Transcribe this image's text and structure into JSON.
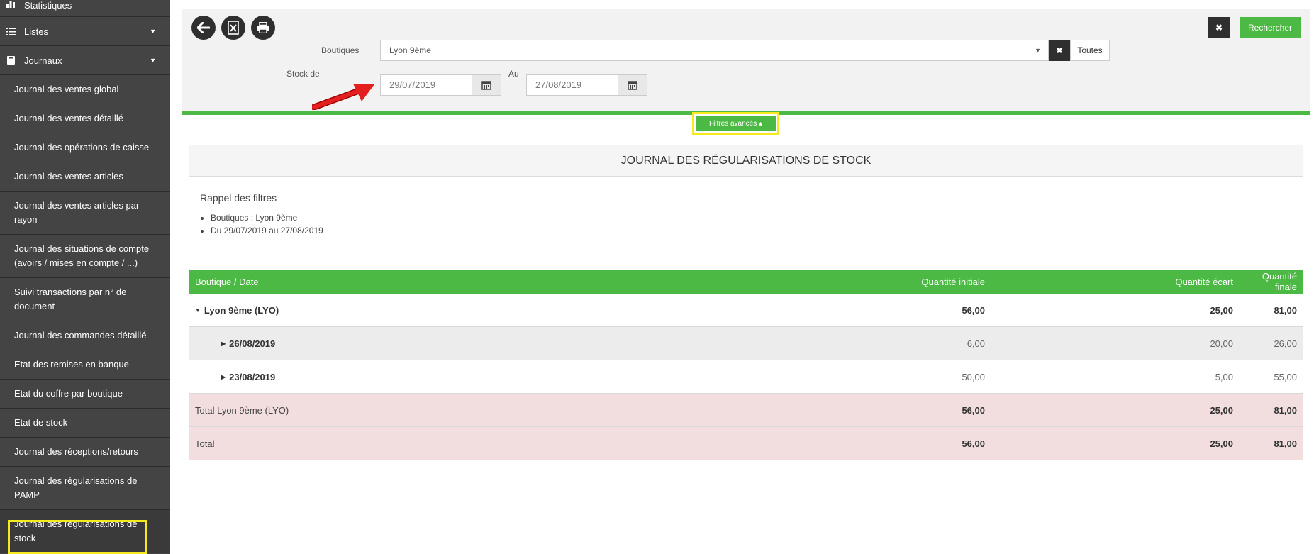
{
  "sidebar": {
    "top_items": [
      {
        "label": "Statistiques",
        "icon": "bar-chart-icon"
      },
      {
        "label": "Listes",
        "icon": "list-icon"
      },
      {
        "label": "Journaux",
        "icon": "book-icon"
      }
    ],
    "items": [
      "Journal des ventes global",
      "Journal des ventes détaillé",
      "Journal des opérations de caisse",
      "Journal des ventes articles",
      "Journal des ventes articles par rayon",
      "Journal des situations de compte (avoirs / mises en compte / ...)",
      "Suivi transactions par n° de document",
      "Journal des commandes détaillé",
      "Etat des remises en banque",
      "Etat du coffre par boutique",
      "Etat de stock",
      "Journal des réceptions/retours",
      "Journal des régularisations de PAMP",
      "Journal des régularisations de stock"
    ]
  },
  "filters": {
    "boutiques_label": "Boutiques",
    "boutiques_value": "Lyon 9ème",
    "toutes_label": "Toutes",
    "stock_label": "Stock de",
    "date_from": "29/07/2019",
    "au_label": "Au",
    "date_to": "27/08/2019",
    "search_label": "Rechercher",
    "advanced_label": "Filtres avancés ▴"
  },
  "report": {
    "title": "JOURNAL DES RÉGULARISATIONS DE STOCK",
    "recap_title": "Rappel des filtres",
    "recap_items": [
      "Boutiques : Lyon 9ème",
      "Du 29/07/2019 au 27/08/2019"
    ],
    "columns": [
      "Boutique / Date",
      "Quantité initiale",
      "Quantité écart",
      "Quantité finale"
    ],
    "rows": [
      {
        "label": "Lyon 9ème (LYO)",
        "qi": "56,00",
        "qe": "25,00",
        "qf": "81,00"
      },
      {
        "label": "26/08/2019",
        "qi": "6,00",
        "qe": "20,00",
        "qf": "26,00"
      },
      {
        "label": "23/08/2019",
        "qi": "50,00",
        "qe": "5,00",
        "qf": "55,00"
      },
      {
        "label": "Total Lyon 9ème (LYO)",
        "qi": "56,00",
        "qe": "25,00",
        "qf": "81,00"
      },
      {
        "label": "Total",
        "qi": "56,00",
        "qe": "25,00",
        "qf": "81,00"
      }
    ]
  },
  "colors": {
    "accent": "#4cb944",
    "sidebar": "#444444",
    "highlight": "#f4ea1e",
    "total_row": "#f2dede"
  }
}
